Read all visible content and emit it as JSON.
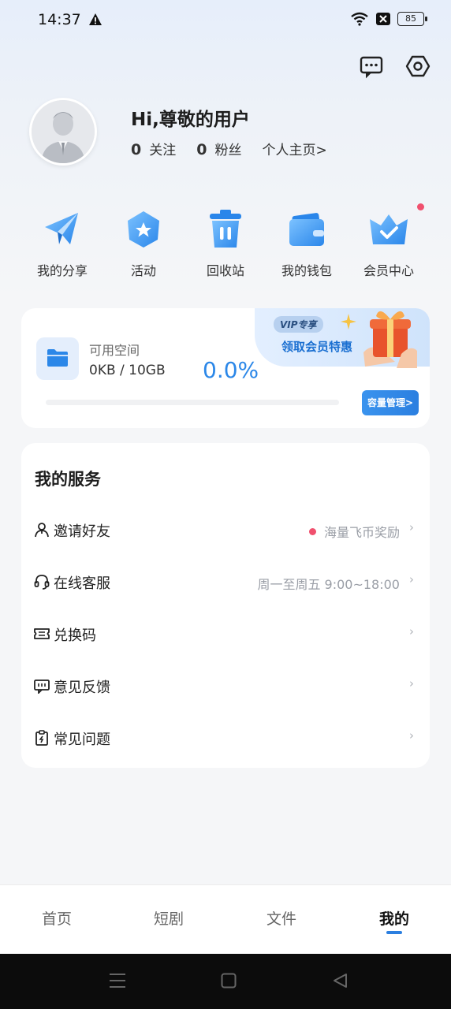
{
  "status_bar": {
    "time": "14:37",
    "battery": "85"
  },
  "profile": {
    "greeting": "Hi,尊敬的用户",
    "following_count": "0",
    "following_label": "关注",
    "followers_count": "0",
    "followers_label": "粉丝",
    "homepage_link": "个人主页>"
  },
  "quick_actions": [
    {
      "label": "我的分享",
      "icon": "paper-plane-icon"
    },
    {
      "label": "活动",
      "icon": "star-badge-icon"
    },
    {
      "label": "回收站",
      "icon": "trash-icon"
    },
    {
      "label": "我的钱包",
      "icon": "wallet-icon"
    },
    {
      "label": "会员中心",
      "icon": "crown-icon"
    }
  ],
  "storage": {
    "vip_tag": "VIP专享",
    "vip_text": "领取会员特惠",
    "available_label": "可用空间",
    "used_total": "0KB / 10GB",
    "percent": "0.0%",
    "percent_value": 0.0,
    "manage_button": "容量管理>"
  },
  "services": {
    "title": "我的服务",
    "items": [
      {
        "label": "邀请好友",
        "right_text": "海量飞币奖励",
        "icon": "person-icon"
      },
      {
        "label": "在线客服",
        "right_text": "周一至周五 9:00~18:00",
        "icon": "headset-icon"
      },
      {
        "label": "兑换码",
        "right_text": "",
        "icon": "ticket-icon"
      },
      {
        "label": "意见反馈",
        "right_text": "",
        "icon": "feedback-icon"
      },
      {
        "label": "常见问题",
        "right_text": "",
        "icon": "clipboard-icon"
      }
    ],
    "chevron": "›"
  },
  "bottom_nav": {
    "tabs": [
      "首页",
      "短剧",
      "文件",
      "我的"
    ],
    "active": "我的"
  },
  "colors": {
    "accent": "#2b87e8",
    "badge": "#f0506e"
  }
}
